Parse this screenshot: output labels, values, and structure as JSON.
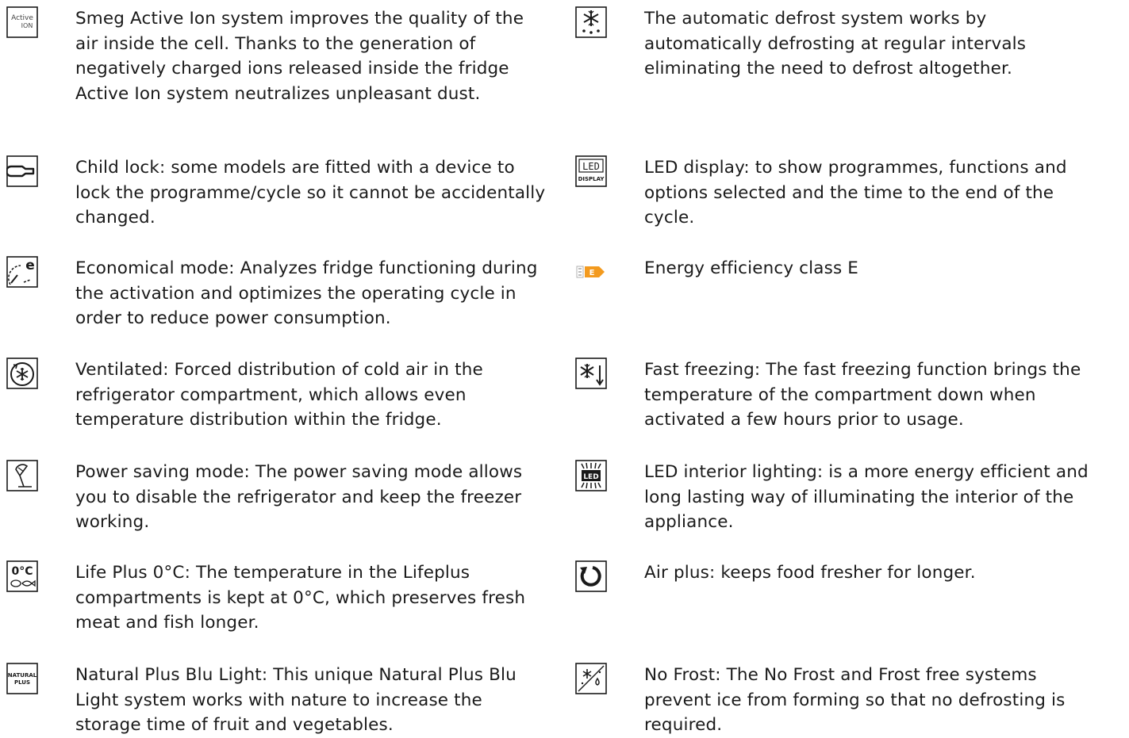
{
  "features": [
    {
      "icon": "active-ion-icon",
      "icon_text": [
        "Active",
        "ION"
      ],
      "text": "Smeg Active Ion system improves the quality of the air inside the cell. Thanks to the generation of negatively charged ions released inside the fridge Active Ion system neutralizes unpleasant dust."
    },
    {
      "icon": "child-lock-icon",
      "text": "Child lock: some models are fitted with a device to lock the programme/cycle so it cannot be accidentally changed."
    },
    {
      "icon": "economical-mode-icon",
      "text": "Economical mode: Analyzes fridge functioning during the activation and optimizes the operating cycle in order to reduce power consumption."
    },
    {
      "icon": "ventilated-icon",
      "text": "Ventilated: Forced distribution of cold air in the refrigerator compartment, which allows even temperature distribution within the fridge."
    },
    {
      "icon": "power-saving-icon",
      "text": "Power saving mode: The power saving mode allows you to disable the refrigerator and keep the freezer working."
    },
    {
      "icon": "life-plus-icon",
      "icon_text": [
        "0°C"
      ],
      "text": "Life Plus 0°C: The temperature in the Lifeplus compartments is kept at 0°C, which preserves fresh meat and fish longer."
    },
    {
      "icon": "natural-plus-icon",
      "icon_text": [
        "NATURAL",
        "PLUS"
      ],
      "text": "Natural Plus Blu Light: This unique Natural Plus Blu Light system works with nature to increase the storage time of fruit and vegetables."
    },
    {
      "icon": "automatic-defrost-icon",
      "text": "The automatic defrost system works by automatically defrosting at regular intervals eliminating the need to defrost altogether."
    },
    {
      "icon": "led-display-icon",
      "icon_text": [
        "LED",
        "DISPLAY"
      ],
      "text": "LED display: to show programmes, functions and options selected and the time to the end of the cycle."
    },
    {
      "icon": "energy-class-icon",
      "icon_text": [
        "E"
      ],
      "text": "Energy efficiency class E"
    },
    {
      "icon": "fast-freezing-icon",
      "text": "Fast freezing: The fast freezing function brings the temperature of the compartment down when activated a few hours prior to usage."
    },
    {
      "icon": "led-lighting-icon",
      "icon_text": [
        "LED"
      ],
      "text": "LED interior lighting: is a more energy efficient and long lasting way of illuminating the interior of the appliance."
    },
    {
      "icon": "air-plus-icon",
      "text": "Air plus: keeps food fresher for longer."
    },
    {
      "icon": "no-frost-icon",
      "text": "No Frost: The No Frost and Frost free systems prevent ice from forming so that no defrosting is required."
    }
  ],
  "colors": {
    "text": "#1a1a1a",
    "icon": "#1a1a1a",
    "energy_orange": "#f39a1e",
    "energy_gray": "#b0b0b0"
  }
}
